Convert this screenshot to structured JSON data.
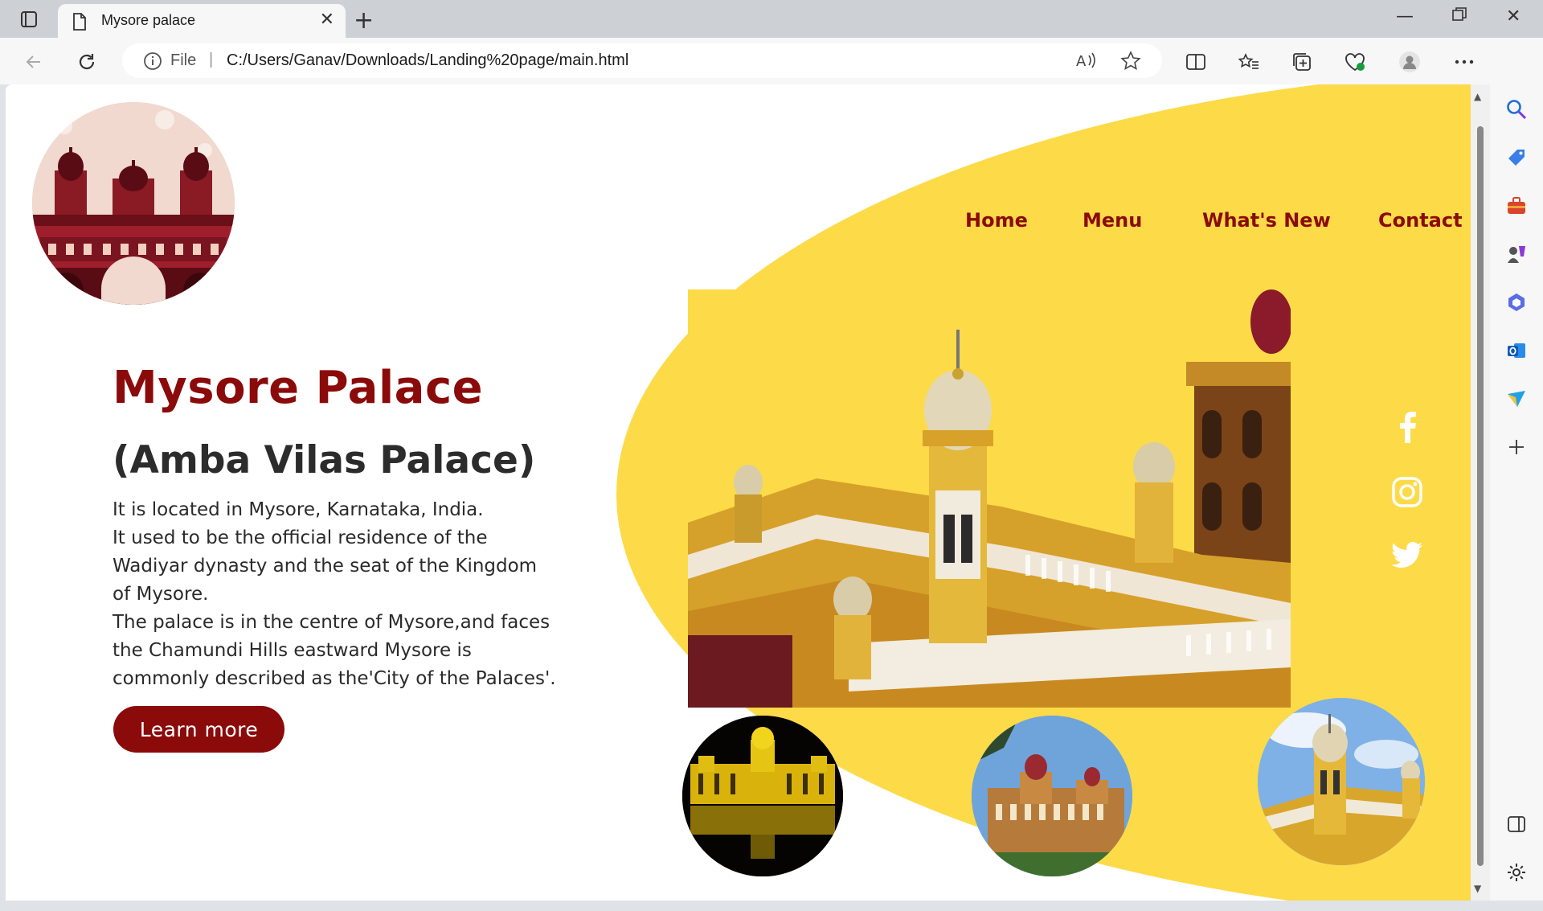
{
  "browser": {
    "tab_title": "Mysore palace",
    "address_scheme": "File",
    "address_url": "C:/Users/Ganav/Downloads/Landing%20page/main.html"
  },
  "page": {
    "nav": [
      "Home",
      "Menu",
      "What's New",
      "Contact"
    ],
    "title": "Mysore Palace",
    "subtitle": "(Amba Vilas Palace)",
    "description_lines": [
      "It is located in Mysore, Karnataka, India.",
      "It used to be the official residence of the",
      "Wadiyar dynasty and the seat of the Kingdom",
      "of Mysore.",
      "The palace is in the centre of Mysore,and faces",
      "the Chamundi Hills eastward Mysore is",
      "commonly described as the'City of the Palaces'."
    ],
    "cta_label": "Learn more",
    "social_icons": [
      "facebook-icon",
      "instagram-icon",
      "twitter-icon"
    ]
  },
  "colors": {
    "accent": "#8b0a0a",
    "yellow": "#fdda48",
    "text": "#2a2a2a"
  }
}
